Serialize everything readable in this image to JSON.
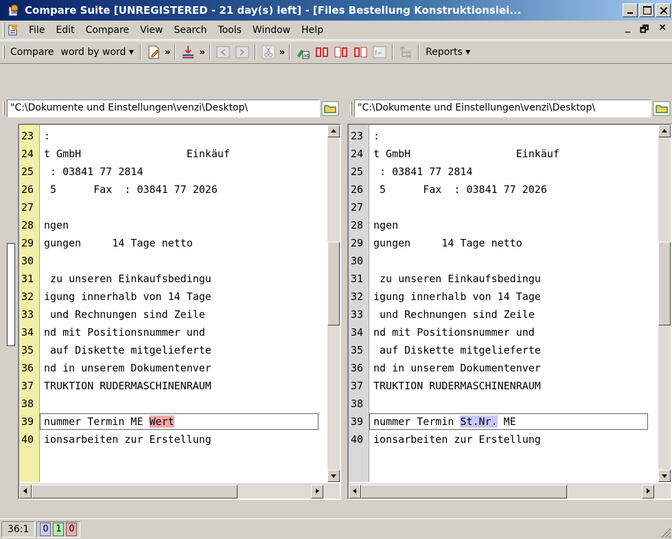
{
  "window": {
    "title": "Compare Suite [UNREGISTERED - 21 day(s) left] - [Files Bestellung Konstruktionslei..."
  },
  "menubar": {
    "items": [
      "File",
      "Edit",
      "Compare",
      "View",
      "Search",
      "Tools",
      "Window",
      "Help"
    ],
    "mdi_controls": [
      "_",
      "̈",
      "×"
    ]
  },
  "toolbar": {
    "compare_label": "Compare",
    "mode_label": "word by word",
    "reports_label": "Reports"
  },
  "left_pane": {
    "path": "\"C:\\Dokumente und Einstellungen\\venzi\\Desktop\\",
    "lines": [
      {
        "num": "23",
        "text": ":"
      },
      {
        "num": "24",
        "text": "t GmbH                 Einkäuf"
      },
      {
        "num": "25",
        "text": " : 03841 77 2814"
      },
      {
        "num": "26",
        "text": " 5      Fax  : 03841 77 2026"
      },
      {
        "num": "27",
        "text": ""
      },
      {
        "num": "28",
        "text": "ngen"
      },
      {
        "num": "29",
        "text": "gungen     14 Tage netto"
      },
      {
        "num": "30",
        "text": ""
      },
      {
        "num": "31",
        "text": " zu unseren Einkaufsbedingu"
      },
      {
        "num": "32",
        "text": "igung innerhalb von 14 Tage"
      },
      {
        "num": "33",
        "text": " und Rechnungen sind Zeile"
      },
      {
        "num": "34",
        "text": "nd mit Positionsnummer und"
      },
      {
        "num": "35",
        "text": " auf Diskette mitgelieferte"
      },
      {
        "num": "36",
        "text": "nd in unserem Dokumentenver"
      },
      {
        "num": "37",
        "text": "TRUKTION RUDERMASCHINENRAUM"
      },
      {
        "num": "38",
        "text": ""
      },
      {
        "num": "39",
        "text": "nummer Termin ME ",
        "highlight": "Wert"
      },
      {
        "num": "40",
        "text": "ionsarbeiten zur Erstellung"
      }
    ]
  },
  "right_pane": {
    "path": "\"C:\\Dokumente und Einstellungen\\venzi\\Desktop\\",
    "lines": [
      {
        "num": "23",
        "text": ":"
      },
      {
        "num": "24",
        "text": "t GmbH                 Einkäuf"
      },
      {
        "num": "25",
        "text": " : 03841 77 2814"
      },
      {
        "num": "26",
        "text": " 5      Fax  : 03841 77 2026"
      },
      {
        "num": "27",
        "text": ""
      },
      {
        "num": "28",
        "text": "ngen"
      },
      {
        "num": "29",
        "text": "gungen     14 Tage netto"
      },
      {
        "num": "30",
        "text": ""
      },
      {
        "num": "31",
        "text": " zu unseren Einkaufsbedingu"
      },
      {
        "num": "32",
        "text": "igung innerhalb von 14 Tage"
      },
      {
        "num": "33",
        "text": " und Rechnungen sind Zeile"
      },
      {
        "num": "34",
        "text": "nd mit Positionsnummer und"
      },
      {
        "num": "35",
        "text": " auf Diskette mitgelieferte"
      },
      {
        "num": "36",
        "text": "nd in unserem Dokumentenver"
      },
      {
        "num": "37",
        "text": "TRUKTION RUDERMASCHINENRAUM"
      },
      {
        "num": "38",
        "text": ""
      },
      {
        "num": "39",
        "text": "nummer Termin ",
        "highlight": "St.Nr.",
        "after": " ME"
      },
      {
        "num": "40",
        "text": "ionsarbeiten zur Erstellung"
      }
    ]
  },
  "statusbar": {
    "position": "36:1",
    "count_changed": "0",
    "count_added": "1",
    "count_deleted": "0"
  },
  "colors": {
    "deleted_highlight": "#f4a8a8",
    "changed_highlight": "#c8c8ff",
    "added_counter": "#b0f0b0",
    "left_gutter": "#f0f0a8",
    "right_gutter": "#d8d8d8",
    "title_bar": "#0a246a"
  }
}
